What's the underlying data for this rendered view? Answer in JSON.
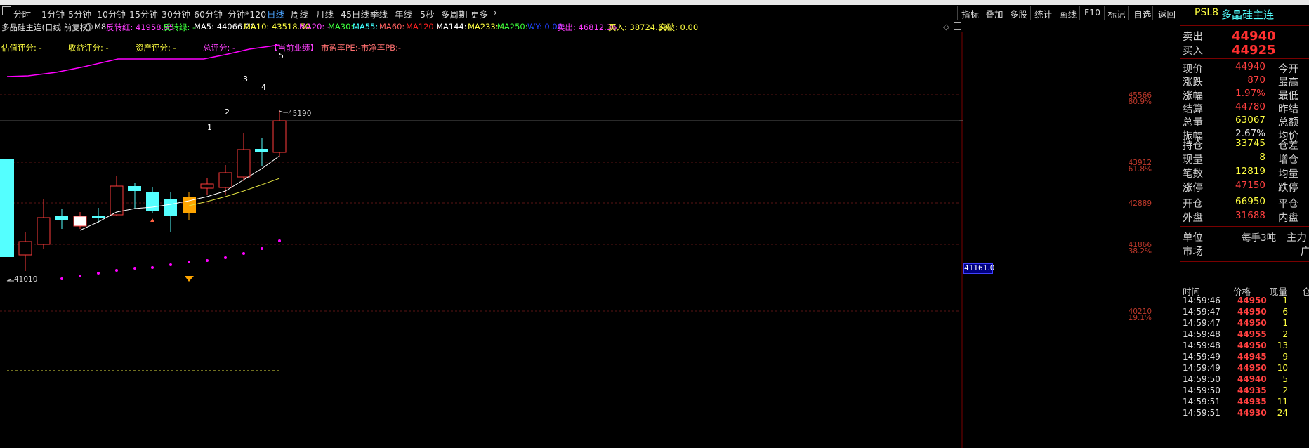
{
  "toolbar": {
    "periods": [
      "分时",
      "1分钟",
      "5分钟",
      "10分钟",
      "15分钟",
      "30分钟",
      "60分钟",
      "分钟*120",
      "日线",
      "周线",
      "月线",
      "45日线",
      "季线",
      "年线",
      "5秒",
      "多周期",
      "更多"
    ],
    "active_period": "日线",
    "right_buttons": [
      "指标",
      "叠加",
      "多股",
      "统计",
      "画线",
      "F10",
      "标记",
      "-自选",
      "返回"
    ],
    "product_code": "PSL8",
    "product_name": "多晶硅主连"
  },
  "infobar": {
    "title": "多晶硅主连(日线 前复权)",
    "m8": "M8",
    "reverse_red": "反转红: 41958.95",
    "reverse_green": "反转绿: -",
    "ma5": "MA5: 44066.00",
    "ma10": "MA10: 43518.50",
    "ma20": "MA20: -",
    "ma30": "MA30: -",
    "ma55": "MA55: -",
    "ma60": "MA60: -",
    "ma120": "MA120 -",
    "ma144": "MA144: -",
    "ma233": "MA233: -",
    "ma250": "MA250: -",
    "wy": "WY: 0.00",
    "sell": "卖出: 46812.36",
    "buy": "买入: 38724.33",
    "breakout": "突破: 0.00",
    "icons": [
      "diamond-icon",
      "expand-icon"
    ]
  },
  "scores": {
    "valuation": "估值评分: -",
    "earnings": "收益评分: -",
    "assets": "资产评分: -",
    "total": "总评分: -",
    "performance": "【当前业绩】",
    "pe_pb": "市盈率PE:-市净率PB:-"
  },
  "chart": {
    "price_axis": [
      {
        "price": "45566",
        "pct": "80.9%"
      },
      {
        "price": "43912",
        "pct": "61.8%"
      },
      {
        "price": "42889",
        "pct": ""
      },
      {
        "price": "41866",
        "pct": "38.2%"
      },
      {
        "price": "40210",
        "pct": "19.1%"
      }
    ],
    "current_marker": "41161.0",
    "high_label": "45190",
    "low_label": "41010",
    "wave_labels": [
      "1",
      "2",
      "3",
      "4",
      "5"
    ],
    "colors": {
      "up": "#ff3b3b",
      "down": "#54ffff",
      "neutral": "#ffffff",
      "highlight": "#ffa500",
      "ma5": "#ffffff",
      "ma10": "#e0e040",
      "magenta": "#ff00ff"
    }
  },
  "quote": {
    "ask_label": "卖出",
    "ask": "44940",
    "bid_label": "买入",
    "bid": "44925",
    "rows": [
      {
        "l": "现价",
        "v": "44940",
        "r": "今开",
        "c": "red"
      },
      {
        "l": "涨跌",
        "v": "870",
        "r": "最高",
        "c": "red"
      },
      {
        "l": "涨幅",
        "v": "1.97%",
        "r": "最低",
        "c": "red"
      },
      {
        "l": "结算",
        "v": "44780",
        "r": "昨结",
        "c": "red"
      },
      {
        "l": "总量",
        "v": "63067",
        "r": "总额",
        "c": "yellow"
      },
      {
        "l": "振幅",
        "v": "2.67%",
        "r": "均价",
        "c": "white"
      }
    ],
    "rows2": [
      {
        "l": "持仓",
        "v": "33745",
        "r": "仓差",
        "c": "yellow"
      },
      {
        "l": "现量",
        "v": "8",
        "r": "增仓",
        "c": "yellow"
      },
      {
        "l": "笔数",
        "v": "12819",
        "r": "均量",
        "c": "yellow"
      },
      {
        "l": "涨停",
        "v": "47150",
        "r": "跌停",
        "c": "red"
      }
    ],
    "rows3": [
      {
        "l": "开仓",
        "v": "66950",
        "r": "平仓",
        "c": "yellow"
      },
      {
        "l": "外盘",
        "v": "31688",
        "r": "内盘",
        "c": "red"
      }
    ],
    "unit_label": "单位",
    "unit_value": "每手3吨",
    "unit_right": "主力",
    "market_label": "市场",
    "market_value": "广",
    "tick_headers": [
      "时间",
      "价格",
      "现量",
      "仓"
    ],
    "ticks": [
      {
        "t": "14:59:46",
        "p": "44950",
        "q": "1"
      },
      {
        "t": "14:59:47",
        "p": "44950",
        "q": "6"
      },
      {
        "t": "14:59:47",
        "p": "44950",
        "q": "1"
      },
      {
        "t": "14:59:48",
        "p": "44955",
        "q": "2"
      },
      {
        "t": "14:59:48",
        "p": "44950",
        "q": "13"
      },
      {
        "t": "14:59:49",
        "p": "44945",
        "q": "9"
      },
      {
        "t": "14:59:49",
        "p": "44950",
        "q": "10"
      },
      {
        "t": "14:59:50",
        "p": "44940",
        "q": "5"
      },
      {
        "t": "14:59:50",
        "p": "44935",
        "q": "2"
      },
      {
        "t": "14:59:51",
        "p": "44935",
        "q": "11"
      },
      {
        "t": "14:59:51",
        "p": "44930",
        "q": "24"
      }
    ]
  }
}
